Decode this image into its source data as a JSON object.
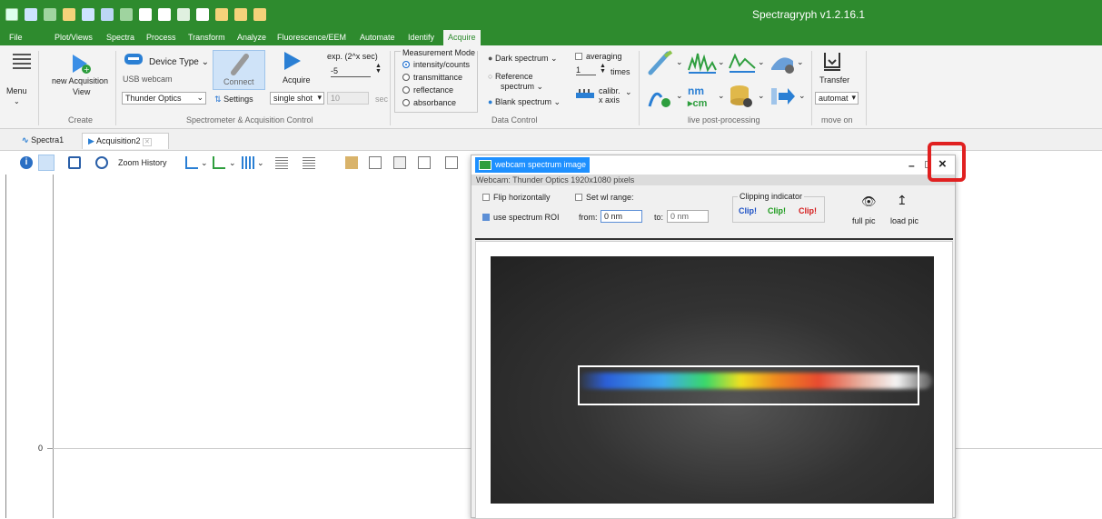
{
  "window": {
    "title": "Spectragryph  v1.2.16.1"
  },
  "menu": [
    "File",
    "Plot/Views",
    "Spectra",
    "Process",
    "Transform",
    "Analyze",
    "Fluorescence/EEM",
    "Automate",
    "Identify",
    "Acquire"
  ],
  "ribbon": {
    "menu_label": "Menu",
    "new_acq_label": "new Acquisition",
    "new_acq_label2": "View",
    "create_group": "Create",
    "device_type": "Device Type",
    "usb_webcam": "USB webcam",
    "device_select": "Thunder Optics",
    "connect": "Connect",
    "settings": "Settings",
    "acquire": "Acquire",
    "exp_label": "exp. (2^x sec)",
    "exp_value": "-5",
    "shot_mode": "single shot",
    "sec_value": "10",
    "sec_unit": "sec",
    "spectrometer_group": "Spectrometer & Acquisition Control",
    "measurement_mode_title": "Measurement Mode",
    "modes": [
      "intensity/counts",
      "transmittance",
      "reflectance",
      "absorbance"
    ],
    "dark_spectrum": "Dark spectrum",
    "reference": "Reference",
    "reference2": "spectrum",
    "blank_spectrum": "Blank spectrum",
    "averaging": "averaging",
    "avg_times_value": "1",
    "avg_times_label": "times",
    "calibr": "calibr.",
    "calibr2": "x axis",
    "data_control_group": "Data Control",
    "live_pp_group": "live post-processing",
    "nm_label": "nm",
    "cm_label": "▸cm",
    "transfer": "Transfer",
    "transfer_select": "automat",
    "move_on_group": "move on"
  },
  "tabs": [
    {
      "label": "Spectra1"
    },
    {
      "label": "Acquisition2"
    }
  ],
  "toolbar": {
    "zoom_history": "Zoom History"
  },
  "plot": {
    "y_zero": "0"
  },
  "webcam_window": {
    "title": "webcam spectrum image",
    "subtitle": "Webcam: Thunder Optics 1920x1080 pixels",
    "flip": "Flip horizontally",
    "set_wl": "Set wl range:",
    "use_roi": "use spectrum ROI",
    "from_label": "from:",
    "from_value": "0 nm",
    "to_label": "to:",
    "to_value": "0 nm",
    "clipping_title": "Clipping indicator",
    "clip_blue": "Clip!",
    "clip_green": "Clip!",
    "clip_red": "Clip!",
    "full_pic": "full pic",
    "load_pic": "load pic",
    "minimize": "–",
    "close": "×"
  },
  "colors": {
    "brand_green": "#2e8b2e",
    "highlight_red": "#e02020",
    "title_blue": "#1e90ff"
  }
}
